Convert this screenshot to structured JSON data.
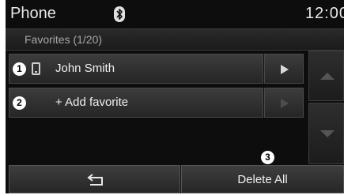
{
  "status_bar": {
    "title": "Phone",
    "bluetooth_icon": "bluetooth-icon",
    "time": "12:00"
  },
  "header": {
    "subtitle": "Favorites (1/20)"
  },
  "favorites": [
    {
      "badge": "1",
      "icon": "mobile-phone-icon",
      "label": "John Smith",
      "arrow": "play-arrow-icon"
    },
    {
      "badge": "2",
      "label": "+ Add favorite",
      "arrow": "play-arrow-icon"
    }
  ],
  "scroll": {
    "up_icon": "scroll-up-icon",
    "down_icon": "scroll-down-icon"
  },
  "bottom_bar": {
    "back_icon": "back-return-icon",
    "delete_badge": "3",
    "delete_label": "Delete All"
  },
  "colors": {
    "background": "#0d0d0d",
    "button": "#333333",
    "text": "#f0f0f0",
    "subtitle": "#a8a8a8"
  }
}
